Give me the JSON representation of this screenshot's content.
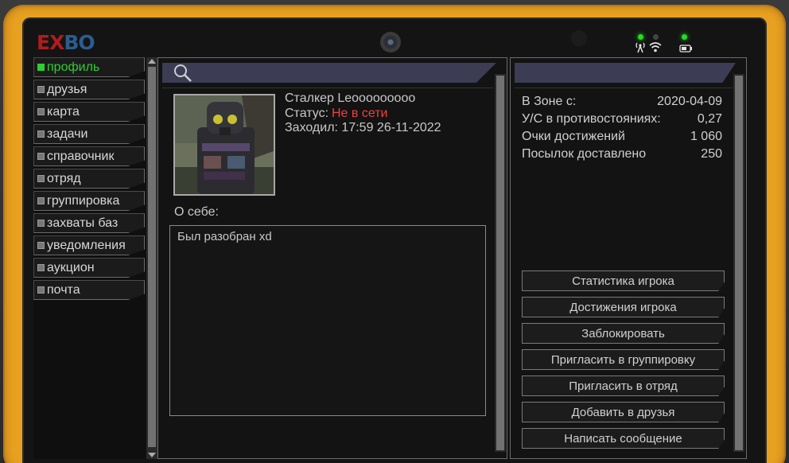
{
  "logo": {
    "part1": "EX",
    "part2": "BO"
  },
  "nav": {
    "items": [
      {
        "label": "профиль",
        "active": true
      },
      {
        "label": "друзья"
      },
      {
        "label": "карта"
      },
      {
        "label": "задачи"
      },
      {
        "label": "справочник"
      },
      {
        "label": "отряд"
      },
      {
        "label": "группировка"
      },
      {
        "label": "захваты баз"
      },
      {
        "label": "уведомления"
      },
      {
        "label": "аукцион"
      },
      {
        "label": "почта"
      }
    ]
  },
  "profile": {
    "name": "Сталкер Leooooooooo",
    "status_label": "Статус:",
    "status_value": "Не в сети",
    "last_seen": "Заходил: 17:59 26-11-2022",
    "about_label": "О себе:",
    "about_text": "Был разобран xd"
  },
  "stats": [
    {
      "label": "В Зоне с:",
      "value": "2020-04-09"
    },
    {
      "label": "У/С в противостояниях:",
      "value": "0,27"
    },
    {
      "label": "Очки достижений",
      "value": "1 060"
    },
    {
      "label": "Посылок доставлено",
      "value": "250"
    }
  ],
  "actions": [
    "Статистика игрока",
    "Достижения игрока",
    "Заблокировать",
    "Пригласить в группировку",
    "Пригласить в отряд",
    "Добавить в друзья",
    "Написать сообщение"
  ],
  "icons": {
    "search": "search-icon",
    "signal": "signal-icon",
    "wifi": "wifi-icon",
    "battery": "battery-icon"
  },
  "colors": {
    "frame": "#e8a020",
    "active_nav": "#2ecf2e",
    "status_offline": "#f04040",
    "panel_header": "#3c3c55"
  }
}
